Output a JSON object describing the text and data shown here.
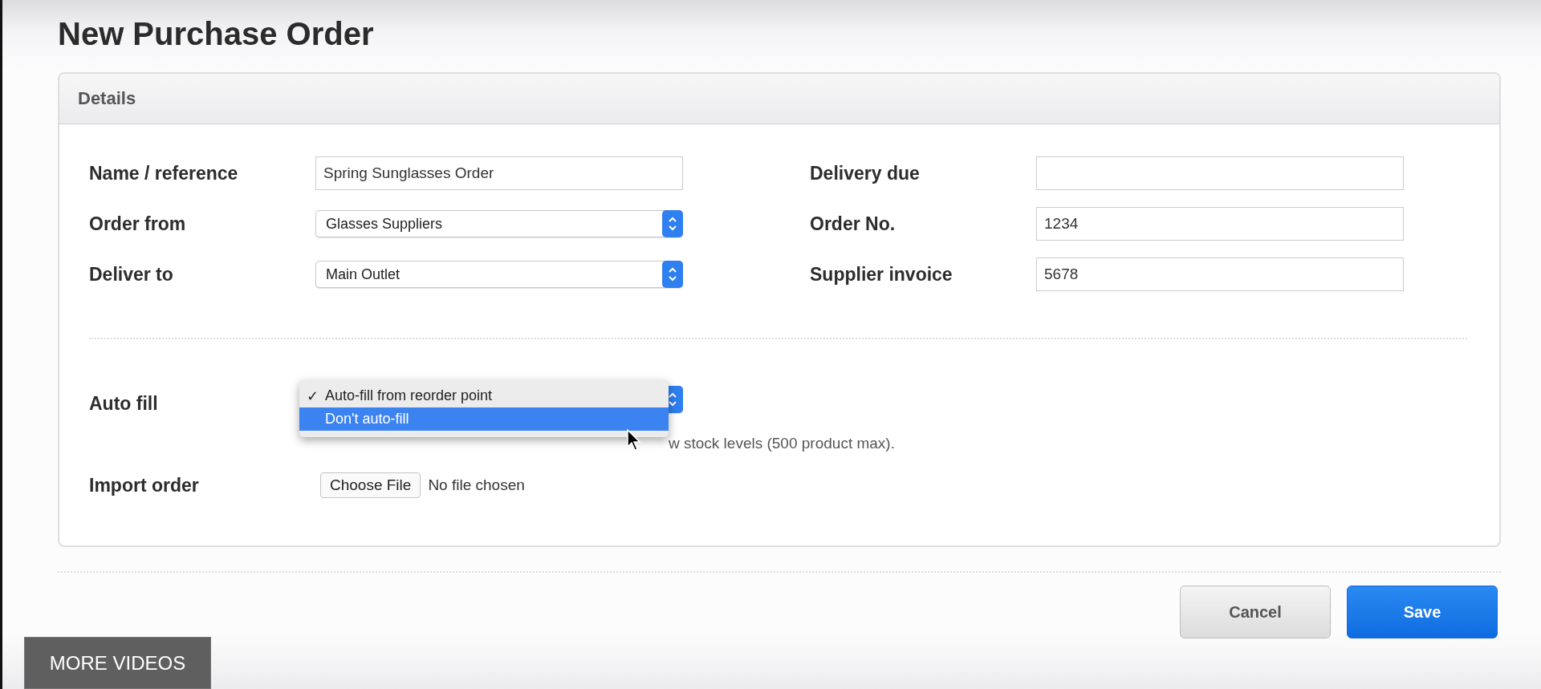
{
  "page": {
    "title": "New Purchase Order"
  },
  "panel": {
    "title": "Details",
    "left_fields": [
      {
        "kind": "text",
        "label": "Name / reference",
        "value": "Spring Sunglasses Order"
      },
      {
        "kind": "select",
        "label": "Order from",
        "value": "Glasses Suppliers"
      },
      {
        "kind": "select",
        "label": "Deliver to",
        "value": "Main Outlet"
      }
    ],
    "right_fields": [
      {
        "kind": "text",
        "label": "Delivery due"
      },
      {
        "kind": "text",
        "label": "Order No.",
        "value": "1234"
      },
      {
        "kind": "text",
        "label": "Supplier invoice",
        "value": "5678"
      }
    ],
    "auto_fill": {
      "label": "Auto fill",
      "check_mark": "✓",
      "help": "w stock levels (500 product max).",
      "options": [
        {
          "label": "Auto-fill from reorder point",
          "checked": true,
          "selected": false
        },
        {
          "label": "Don't auto-fill",
          "checked": false,
          "selected": true
        }
      ]
    },
    "import_order": {
      "label": "Import order",
      "button": "Choose File",
      "status": "No file chosen"
    }
  },
  "buttons": [
    {
      "label": "Cancel",
      "kind": "secondary"
    },
    {
      "label": "Save",
      "kind": "primary"
    }
  ],
  "overlay_button": "MORE VIDEOS"
}
